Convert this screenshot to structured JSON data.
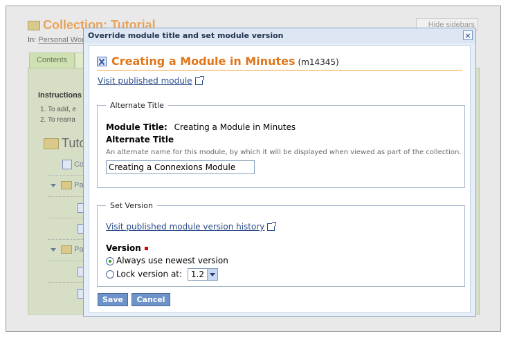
{
  "background": {
    "collection_title": "Collection: Tutorial",
    "in_prefix": "In:",
    "in_link": "Personal Wor",
    "hide_sidebars": "Hide sidebars",
    "contents_tab": "Contents",
    "instructions": "Instructions",
    "instruction_lines": [
      "1.  To add, e",
      "2.  To rearra"
    ],
    "tree_root": "Tuto",
    "tree_items": [
      "Co",
      "Pa",
      "Pa"
    ]
  },
  "dialog": {
    "title": "Override module title and set module version",
    "close_label": "×",
    "module": {
      "title": "Creating a Module in Minutes",
      "id": "(m14345)"
    },
    "visit_published": "Visit published module",
    "alternate_fieldset": {
      "legend": "Alternate Title",
      "module_title_label": "Module Title:",
      "module_title_value": "Creating a Module in Minutes",
      "alt_title_label": "Alternate Title",
      "alt_title_help": "An alternate name for this module, by which it will be displayed when viewed as part of the collection.",
      "alt_title_value": "Creating a Connexions Module"
    },
    "version_fieldset": {
      "legend": "Set Version",
      "history_link": "Visit published module version history",
      "version_label": "Version",
      "option_newest": "Always use newest version",
      "option_lock": "Lock version at:",
      "lock_value": "1.2",
      "selected": "newest"
    },
    "buttons": {
      "save": "Save",
      "cancel": "Cancel"
    }
  }
}
